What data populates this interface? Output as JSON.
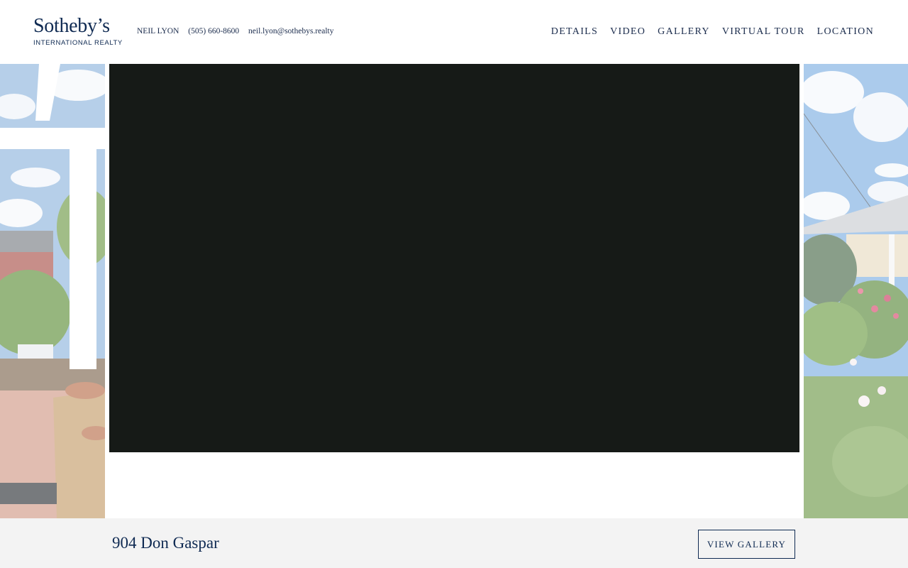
{
  "header": {
    "logo": {
      "main": "Sotheby’s",
      "sub": "INTERNATIONAL REALTY"
    },
    "agent": {
      "name": "NEIL LYON",
      "phone": "(505) 660-8600",
      "email": "neil.lyon@sothebys.realty"
    },
    "nav": [
      {
        "label": "DETAILS"
      },
      {
        "label": "VIDEO"
      },
      {
        "label": "GALLERY"
      },
      {
        "label": "VIRTUAL TOUR"
      },
      {
        "label": "LOCATION"
      }
    ]
  },
  "footer": {
    "address": "904 Don Gaspar",
    "view_gallery_label": "VIEW GALLERY"
  },
  "colors": {
    "brand_navy": "#0f2a52",
    "video_bg": "#161a17",
    "footer_bg": "#f3f3f3"
  }
}
